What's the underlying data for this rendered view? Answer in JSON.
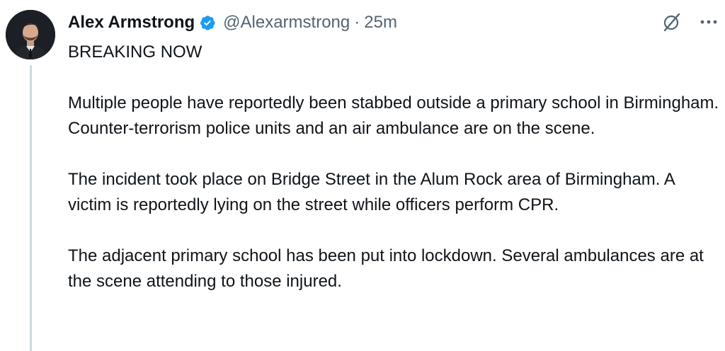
{
  "tweet": {
    "author": {
      "display_name": "Alex Armstrong",
      "handle": "@Alexarmstrong",
      "verified": true
    },
    "separator": "·",
    "time_ago": "25m",
    "paragraphs": [
      "BREAKING NOW",
      "Multiple people have reportedly been stabbed outside a primary school in Birmingham. Counter-terrorism police units and an air ambulance are on the scene.",
      "The incident took place on Bridge Street in the Alum Rock area of Birmingham. A victim is reportedly lying on the street while officers perform CPR.",
      "The adjacent primary school has been put into lockdown. Several ambulances are at the scene attending to those injured."
    ]
  },
  "icons": {
    "verified": "verified-badge-icon",
    "grok": "grok-icon",
    "more": "more-options-icon"
  },
  "colors": {
    "text": "#0f1419",
    "secondary": "#536471",
    "verified": "#1d9bf0",
    "thread_line": "#cfd9de"
  }
}
